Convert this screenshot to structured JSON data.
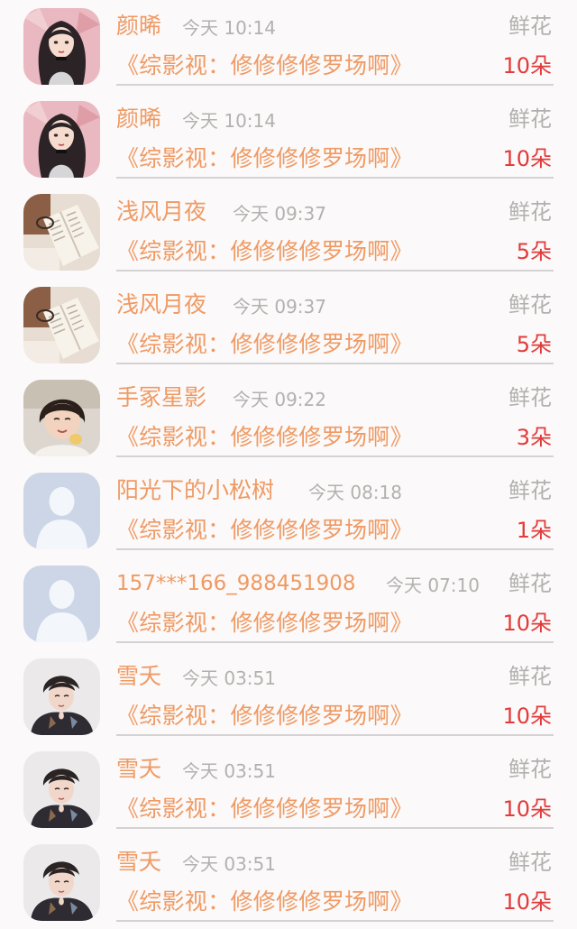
{
  "gift_records": [
    {
      "avatar": "avatar-girl-long-hair",
      "name": "颜晞",
      "time": "今天 10:14",
      "gift_type": "鲜花",
      "book": "《综影视：修修修修罗场啊》",
      "count": "10朵"
    },
    {
      "avatar": "avatar-girl-long-hair",
      "name": "颜晞",
      "time": "今天 10:14",
      "gift_type": "鲜花",
      "book": "《综影视：修修修修罗场啊》",
      "count": "10朵"
    },
    {
      "avatar": "avatar-open-book",
      "name": "浅风月夜",
      "time": "今天 09:37",
      "gift_type": "鲜花",
      "book": "《综影视：修修修修罗场啊》",
      "count": "5朵"
    },
    {
      "avatar": "avatar-open-book",
      "name": "浅风月夜",
      "time": "今天 09:37",
      "gift_type": "鲜花",
      "book": "《综影视：修修修修罗场啊》",
      "count": "5朵"
    },
    {
      "avatar": "avatar-little-girl",
      "name": "手冢星影",
      "time": "今天 09:22",
      "gift_type": "鲜花",
      "book": "《综影视：修修修修罗场啊》",
      "count": "3朵"
    },
    {
      "avatar": "avatar-default-silhouette",
      "name": "阳光下的小松树",
      "time": "今天 08:18",
      "gift_type": "鲜花",
      "book": "《综影视：修修修修罗场啊》",
      "count": "1朵"
    },
    {
      "avatar": "avatar-default-silhouette",
      "name": "157***166_988451908",
      "time": "今天 07:10",
      "gift_type": "鲜花",
      "book": "《综影视：修修修修罗场啊》",
      "count": "10朵"
    },
    {
      "avatar": "avatar-young-man",
      "name": "雪夭",
      "time": "今天 03:51",
      "gift_type": "鲜花",
      "book": "《综影视：修修修修罗场啊》",
      "count": "10朵"
    },
    {
      "avatar": "avatar-young-man",
      "name": "雪夭",
      "time": "今天 03:51",
      "gift_type": "鲜花",
      "book": "《综影视：修修修修罗场啊》",
      "count": "10朵"
    },
    {
      "avatar": "avatar-young-man",
      "name": "雪夭",
      "time": "今天 03:51",
      "gift_type": "鲜花",
      "book": "《综影视：修修修修罗场啊》",
      "count": "10朵"
    }
  ],
  "colors": {
    "name": "#ef9a64",
    "book": "#ef9a64",
    "muted": "#b4b0b0",
    "count": "#e23b3b",
    "background": "#fbf9f9",
    "divider": "#d4d2d2"
  }
}
